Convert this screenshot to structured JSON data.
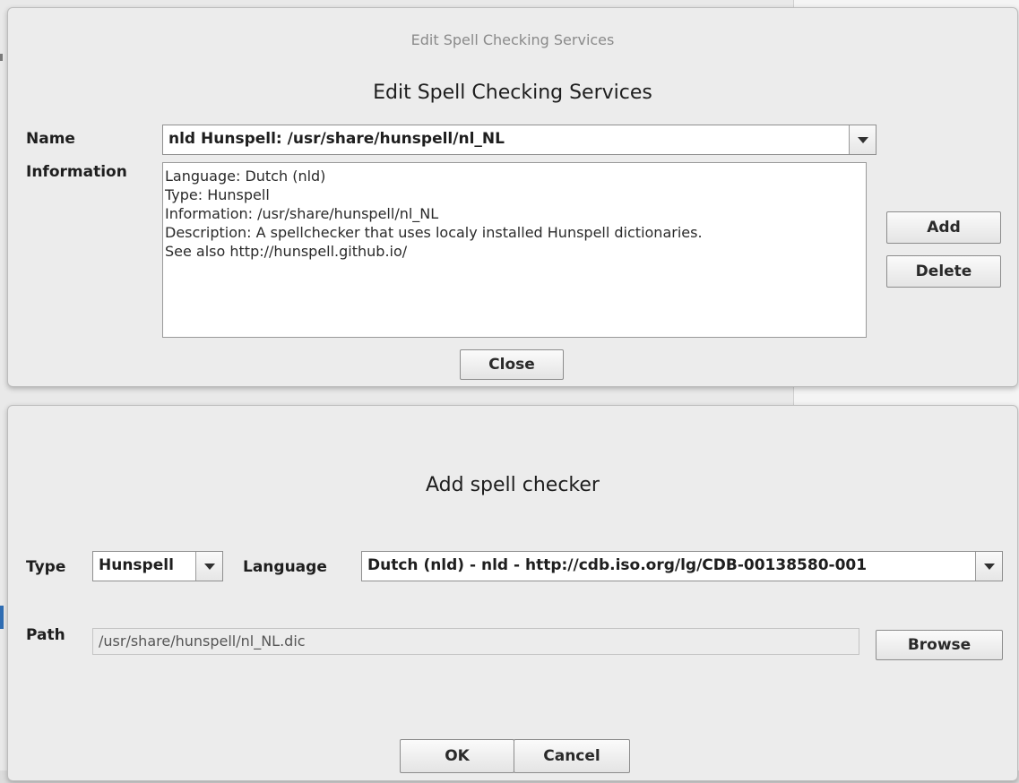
{
  "spell_services_dialog": {
    "window_title": "Edit Spell Checking Services",
    "heading": "Edit Spell Checking Services",
    "name_label": "Name",
    "name_value": "nld Hunspell: /usr/share/hunspell/nl_NL",
    "information_label": "Information",
    "information_lines": [
      "Language: Dutch (nld)",
      "Type: Hunspell",
      "Information: /usr/share/hunspell/nl_NL",
      "Description: A spellchecker that uses localy installed Hunspell dictionaries.",
      "See also http://hunspell.github.io/"
    ],
    "add_label": "Add",
    "delete_label": "Delete",
    "close_label": "Close"
  },
  "add_dialog": {
    "heading": "Add spell checker",
    "type_label": "Type",
    "type_value": "Hunspell",
    "language_label": "Language",
    "language_value": "Dutch (nld) - nld - http://cdb.iso.org/lg/CDB-00138580-001",
    "path_label": "Path",
    "path_value": "/usr/share/hunspell/nl_NL.dic",
    "browse_label": "Browse",
    "ok_label": "OK",
    "cancel_label": "Cancel"
  }
}
